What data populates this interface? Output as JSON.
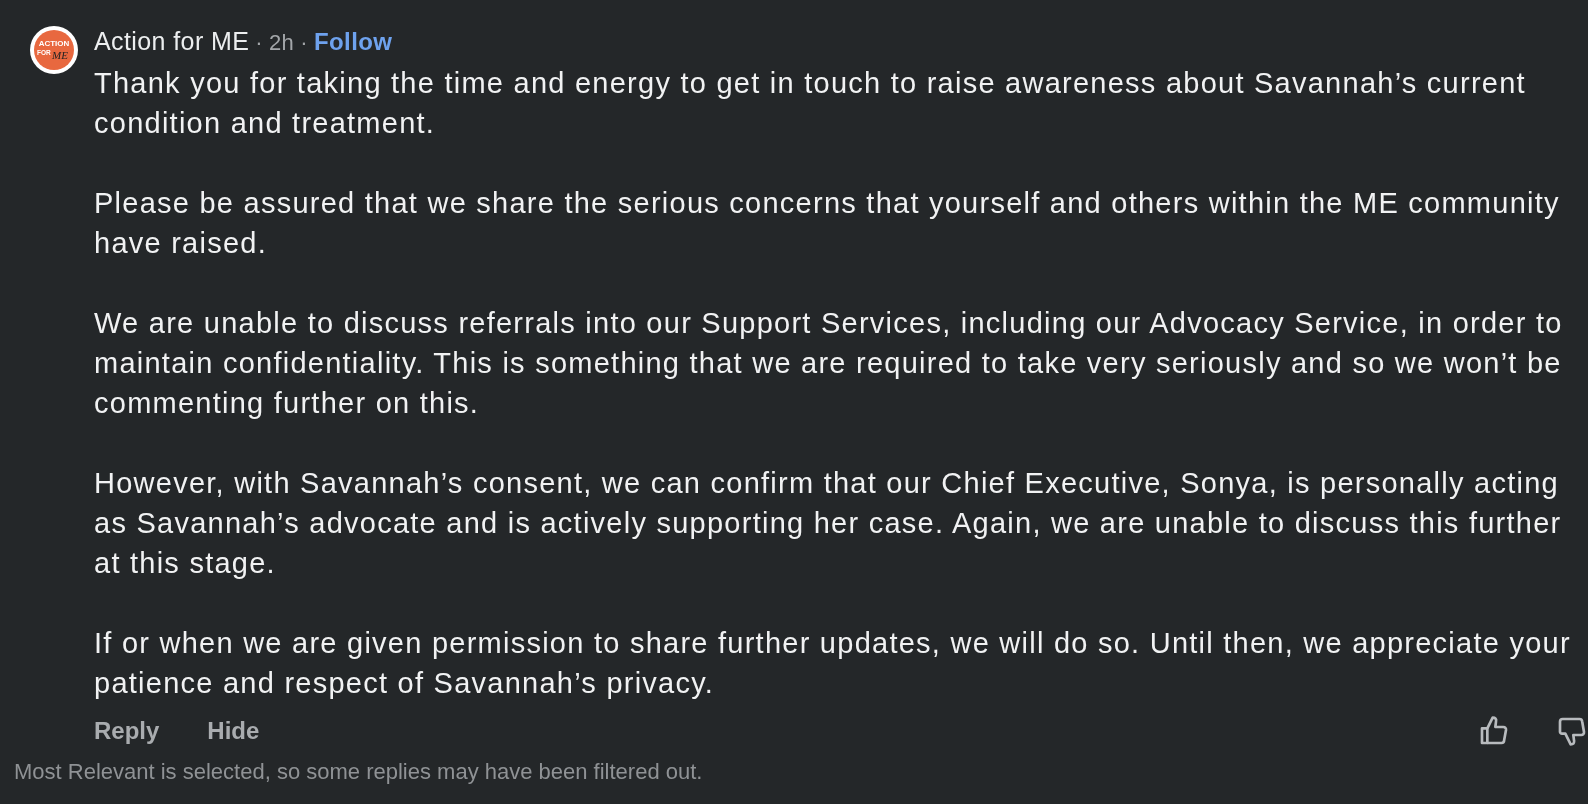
{
  "comment": {
    "author": "Action for ME",
    "separator": "·",
    "time": "2h",
    "follow": "Follow",
    "avatar_text": [
      "ACTION",
      "FOR",
      "ME"
    ],
    "paragraphs": [
      "Thank you for taking the time and energy to get in touch to raise awareness about Savannah’s current condition and treatment.",
      "Please be assured that we share the serious concerns that yourself and others within the ME community have raised.",
      "We are unable to discuss referrals into our Support Services, including our Advocacy Service, in order to maintain confidentiality. This is something that we are required to take very seriously and so we won’t be commenting further on this.",
      "However, with Savannah’s consent, we can confirm that our Chief Executive, Sonya, is personally acting as Savannah’s advocate and is actively supporting her case. Again, we are unable to discuss this further at this stage.",
      "If or when we are given permission to share further updates, we will do so. Until then, we appreciate your patience and respect of Savannah’s privacy."
    ],
    "actions": [
      "Reply",
      "Hide"
    ]
  },
  "notice": "Most Relevant is selected, so some replies may have been filtered out."
}
